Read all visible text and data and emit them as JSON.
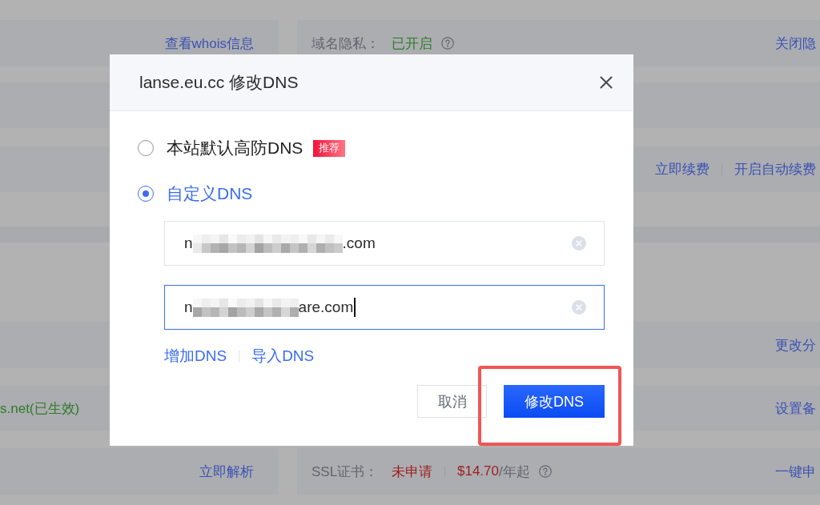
{
  "page": {
    "rows": [
      {
        "left": {
          "actions": [
            {
              "kind": "link",
              "text": "查看whois信息"
            }
          ]
        },
        "right": {
          "values": [
            {
              "kind": "label",
              "text": "域名隐私："
            },
            {
              "kind": "status",
              "text": "已开启",
              "color": "#2f7b2b"
            },
            {
              "kind": "help"
            }
          ],
          "actions": [
            {
              "kind": "link",
              "text": "关闭隐"
            }
          ]
        }
      },
      {
        "right": {
          "actions": [
            {
              "kind": "link",
              "text": "立即续费"
            },
            {
              "kind": "divider"
            },
            {
              "kind": "link",
              "text": "开启自动续费"
            }
          ]
        }
      },
      {
        "right": {
          "actions": [
            {
              "kind": "link",
              "text": "更改分"
            }
          ]
        }
      },
      {
        "left": {
          "values": [
            {
              "kind": "status",
              "text": "s.net(已生效)",
              "color": "#2f7b2b"
            }
          ]
        },
        "right": {
          "actions": [
            {
              "kind": "link",
              "text": "设置备"
            }
          ]
        }
      },
      {
        "left": {
          "actions": [
            {
              "kind": "link",
              "text": "立即解析"
            }
          ]
        },
        "right": {
          "values": [
            {
              "kind": "label",
              "text": "SSL证书："
            },
            {
              "kind": "status",
              "text": "未申请",
              "color": "#9d1d1d"
            },
            {
              "kind": "divider"
            },
            {
              "kind": "status",
              "text": "$14.70",
              "color": "#9d1d1d"
            },
            {
              "kind": "label",
              "text": "/年起"
            },
            {
              "kind": "help"
            }
          ],
          "actions": [
            {
              "kind": "link",
              "text": "一键申"
            }
          ]
        }
      }
    ]
  },
  "dialog": {
    "title": "lanse.eu.cc 修改DNS",
    "options": [
      {
        "label": "本站默认高防DNS",
        "selected": false,
        "badge": "推荐"
      },
      {
        "label": "自定义DNS",
        "selected": true
      }
    ],
    "dns_fields": [
      {
        "value_start": "n",
        "value_end": ".com",
        "focused": false
      },
      {
        "value_start": "n",
        "value_end": "are.com",
        "focused": true
      }
    ],
    "links": [
      "增加DNS",
      "导入DNS"
    ],
    "buttons": [
      {
        "label": "取消",
        "kind": "secondary"
      },
      {
        "label": "修改DNS",
        "kind": "primary"
      }
    ],
    "annotations": [
      {
        "kind": "box"
      }
    ]
  }
}
